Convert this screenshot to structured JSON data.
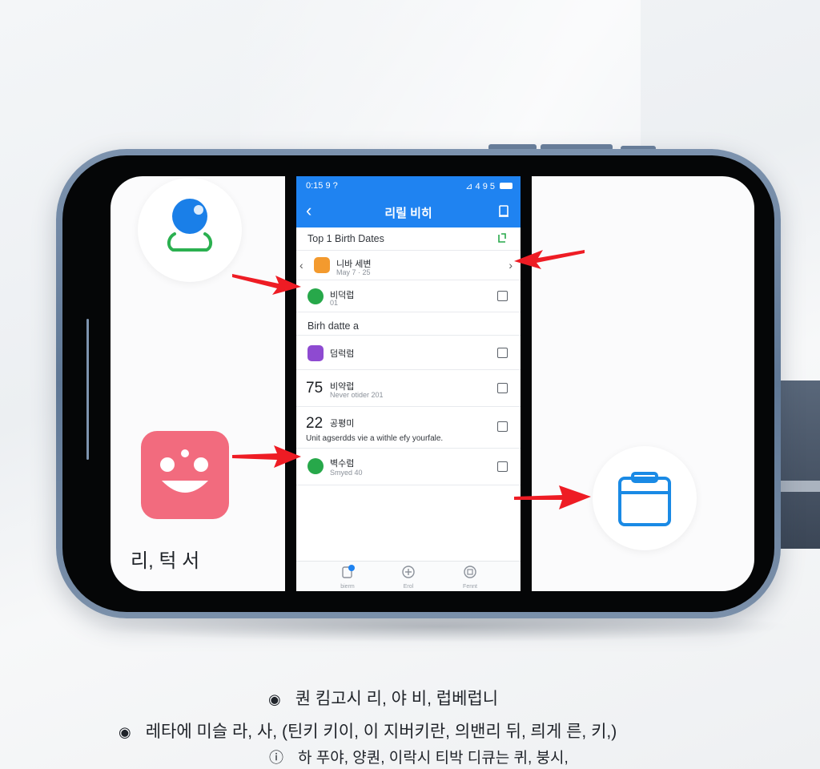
{
  "app": {
    "status_time": "0:15 9 ? ",
    "status_signal": "⊿ 4 9 5",
    "header_title": "리릴 비히",
    "back_glyph": "‹"
  },
  "sections": [
    {
      "title": "Top 1  Birth Dates"
    },
    {
      "title": "Birh datte a"
    }
  ],
  "rows": [
    {
      "name": "니바 세변",
      "sub": "May 7 · 25",
      "badge_color": "#f39a2e",
      "has_checkbox": false
    },
    {
      "name": "비덕럽",
      "sub": "01",
      "badge_color": "#27a84a",
      "has_checkbox": true
    },
    {
      "name": "덤럭럼",
      "sub": "",
      "badge_color": "#8e4ad1",
      "has_checkbox": true
    },
    {
      "num": "75",
      "name": "비약럽",
      "sub": "Never otider 201",
      "has_checkbox": true
    },
    {
      "num": "22",
      "name": "공평미",
      "sub": "Unit agserdds vie a withle efy yourfale.",
      "has_checkbox": true
    },
    {
      "name": "벽수럼",
      "sub": "Smyed 40",
      "badge_color": "#27a84a",
      "has_checkbox": true
    }
  ],
  "tabs": [
    {
      "label": "bierm",
      "icon": "contacts-icon",
      "badge": "4"
    },
    {
      "label": "Erol",
      "icon": "add-icon"
    },
    {
      "label": "Fennt",
      "icon": "calendar-icon"
    }
  ],
  "left_panel": {
    "caption": "리, 턱 서"
  },
  "bottom_text": [
    "퀀 킴고시 리,  야  비,  럽베럽니",
    "레타에 미슬 라,  사, (틴키 키이,  이 지버키란, 의밴리 뒤,  릐게  른, 키,)",
    "하 푸야, 양퀀, 이락시 티박 디큐는 퀴, 붕시,"
  ],
  "colors": {
    "app_blue": "#1f83f1",
    "arrow_red": "#ee1c24",
    "smile_tile": "#f26b7e",
    "clip_icon_blue": "#1a8ae5",
    "avatar_green": "#2bb050"
  }
}
